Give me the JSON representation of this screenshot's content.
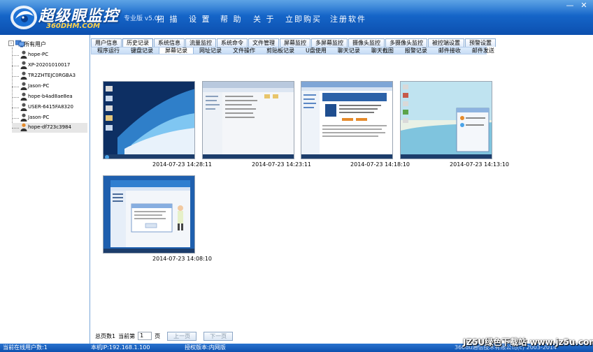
{
  "header": {
    "app_title": "超级眼监控",
    "brand": "360DHM.COM",
    "version": "专业版 v5.02",
    "menu": [
      "扫 描",
      "设 置",
      "帮 助",
      "关 于",
      "立即购买",
      "注册软件"
    ],
    "min_glyph": "—",
    "close_glyph": "✕"
  },
  "tree": {
    "expander": "-",
    "root_label": "所有用户",
    "users": [
      "hope-PC",
      "XP-20201010017",
      "TR2ZHTEJC0RGBA3",
      "Jason-PC",
      "hope-b4ad8ae8ea",
      "USER-6415FA8320",
      "Jason-PC",
      "hope-df723c3984"
    ]
  },
  "tabs": {
    "row1": [
      "用户信息",
      "历史记录",
      "系统信息",
      "流量监控",
      "系统命令",
      "文件管理",
      "屏幕监控",
      "多屏幕监控",
      "摄像头监控",
      "多摄像头监控",
      "被控端设置",
      "预警设置"
    ],
    "row2": [
      "程序运行",
      "键盘记录",
      "屏幕记录",
      "网址记录",
      "文件操作",
      "剪贴板记录",
      "U盘使用",
      "聊天记录",
      "聊天截图",
      "报警记录",
      "邮件接收",
      "邮件发送"
    ]
  },
  "screenshots": [
    {
      "timestamp": "2014-07-23 14:28:11"
    },
    {
      "timestamp": "2014-07-23 14:23:11"
    },
    {
      "timestamp": "2014-07-23 14:18:10"
    },
    {
      "timestamp": "2014-07-23 14:13:10"
    },
    {
      "timestamp": "2014-07-23 14:08:10"
    }
  ],
  "pager": {
    "total_label": "总页数1",
    "current_label": "当前第",
    "current_value": "1",
    "page_suffix": "页",
    "prev_label": "上一页",
    "next_label": "下一页"
  },
  "status": {
    "online": "当前在线用户数:1",
    "local_ip": "本机IP:192.168.1.100",
    "auth": "授权版本:内网版",
    "copyright": "360du通信技术有限公司(c) 2003-2014"
  },
  "watermark": "JZ5U绿色下载站  www.jz5u.com",
  "colors": {
    "header": "#1565c8",
    "tab_border": "#8fb0d6",
    "status_bar": "#0c4fae"
  }
}
